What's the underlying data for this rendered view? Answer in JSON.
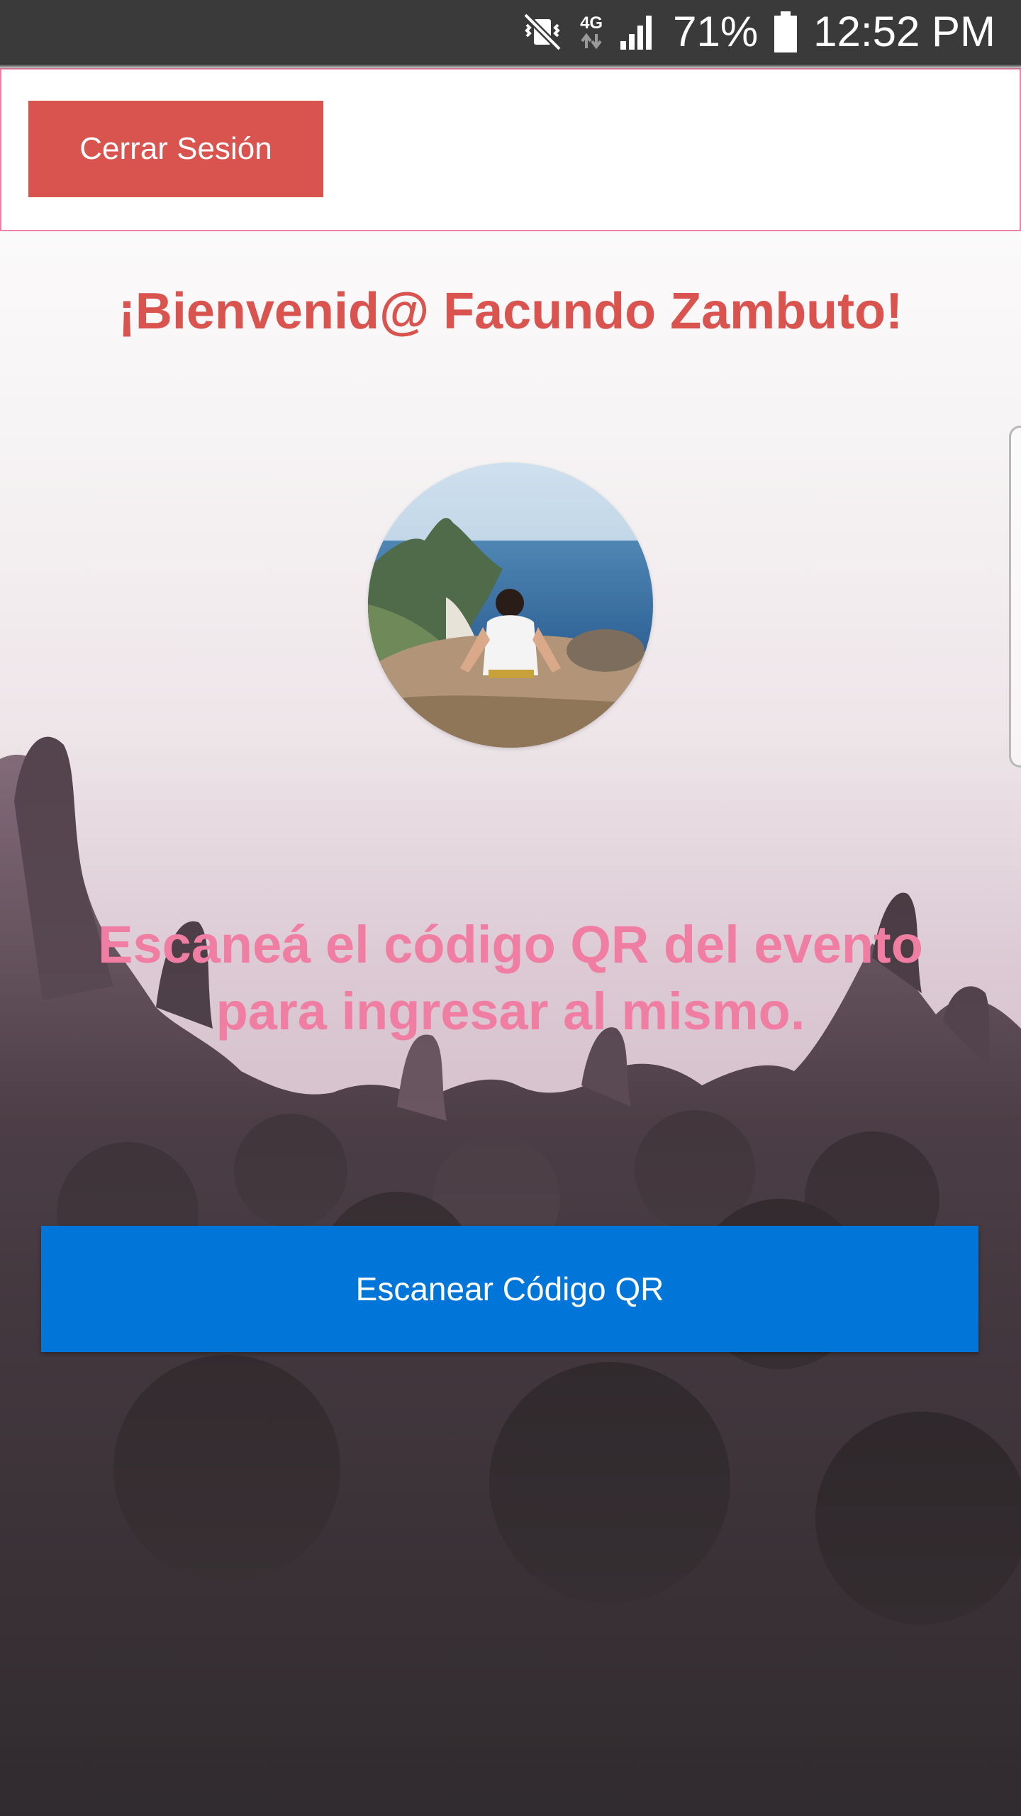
{
  "status_bar": {
    "network": "4G",
    "battery": "71%",
    "time": "12:52 PM",
    "icons": [
      "vibrate-mute-icon",
      "data-arrows-icon",
      "signal-icon",
      "battery-icon"
    ]
  },
  "header": {
    "logout_label": "Cerrar Sesión"
  },
  "main": {
    "welcome": "¡Bienvenid@ Facundo Zambuto!",
    "instruction": "Escaneá el código QR del evento para ingresar al mismo.",
    "scan_button_label": "Escanear Código QR"
  },
  "colors": {
    "status_bar": "#3a3a3a",
    "logout_button": "#d9534f",
    "welcome_text": "#d9534f",
    "top_bar_border": "#ee82a6",
    "instruction_text": "#f07ea3",
    "scan_button": "#0275d8"
  }
}
